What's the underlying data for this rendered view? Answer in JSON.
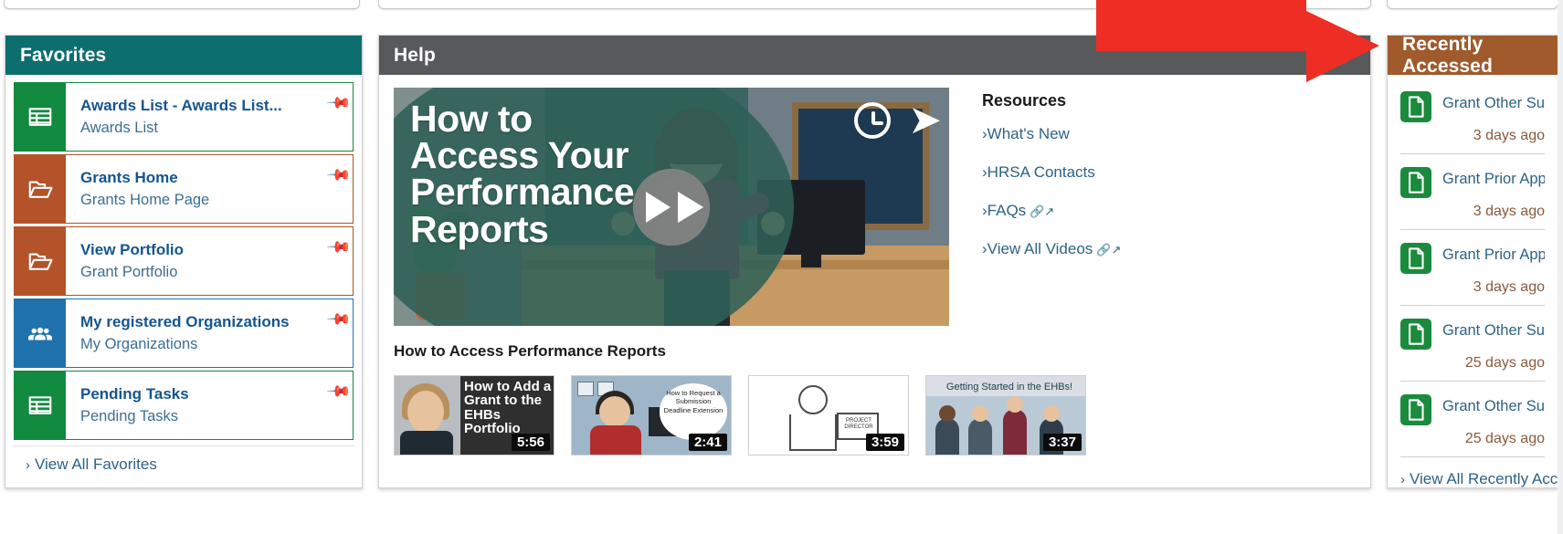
{
  "favorites": {
    "header": "Favorites",
    "items": [
      {
        "title": "Awards List - Awards List...",
        "subtitle": "Awards List",
        "icon": "table-list-icon",
        "color": "#128a3f",
        "pin": "pin-icon"
      },
      {
        "title": "Grants Home",
        "subtitle": "Grants Home Page",
        "icon": "open-folder-icon",
        "color": "#b4522a",
        "pin": "pin-icon"
      },
      {
        "title": "View Portfolio",
        "subtitle": "Grant Portfolio",
        "icon": "open-folder-icon",
        "color": "#b4522a",
        "pin": "pin-icon"
      },
      {
        "title": "My registered Organizations",
        "subtitle": "My Organizations",
        "icon": "people-group-icon",
        "color": "#1f72ac",
        "pin": "pin-icon"
      },
      {
        "title": "Pending Tasks",
        "subtitle": "Pending Tasks",
        "icon": "table-list-icon",
        "color": "#128a3f",
        "pin": "pin-icon"
      }
    ],
    "view_all": "View All Favorites"
  },
  "help": {
    "header": "Help",
    "video": {
      "title_lines": [
        "How to",
        "Access Your",
        "Performance",
        "Reports"
      ],
      "play_button": "play-button",
      "watch_later": "clock-icon",
      "share": "share-icon"
    },
    "caption": "How to Access Performance Reports",
    "resources": {
      "title": "Resources",
      "links": [
        {
          "label": "What's New",
          "external": false
        },
        {
          "label": "HRSA Contacts",
          "external": false
        },
        {
          "label": "FAQs",
          "external": true
        },
        {
          "label": "View All Videos",
          "external": true
        }
      ]
    },
    "thumbnails": [
      {
        "title": "How to Add a Grant to the EHBs Portfolio",
        "duration": "5:56"
      },
      {
        "title": "How to Request a Submission Deadline Extension",
        "duration": "2:41"
      },
      {
        "title": "Project Director",
        "duration": "3:59"
      },
      {
        "title": "Getting Started in the EHBs!",
        "duration": "3:37"
      }
    ]
  },
  "recent": {
    "header": "Recently Accessed",
    "items": [
      {
        "name": "Grant Other Submissions - Q...",
        "time": "3 days ago",
        "icon": "document-icon"
      },
      {
        "name": "Grant Prior Approvals - Other...",
        "time": "3 days ago",
        "icon": "document-icon"
      },
      {
        "name": "Grant Prior Approvals - Track...",
        "time": "3 days ago",
        "icon": "document-icon"
      },
      {
        "name": "Grant Other Submissions - Fi...",
        "time": "25 days ago",
        "icon": "document-icon"
      },
      {
        "name": "Grant Other Submissions - Sl...",
        "time": "25 days ago",
        "icon": "document-icon"
      }
    ],
    "view_all": "View All Recently Accessed"
  },
  "annotation": {
    "arrow": "red-arrow-pointer",
    "color": "#ee2e24"
  },
  "colors": {
    "favorites_header": "#0d6e6e",
    "help_header": "#58595b",
    "recent_header": "#a05a2c",
    "link": "#2d6286",
    "title_link": "#14558f",
    "time_text": "#8a5a3c"
  }
}
